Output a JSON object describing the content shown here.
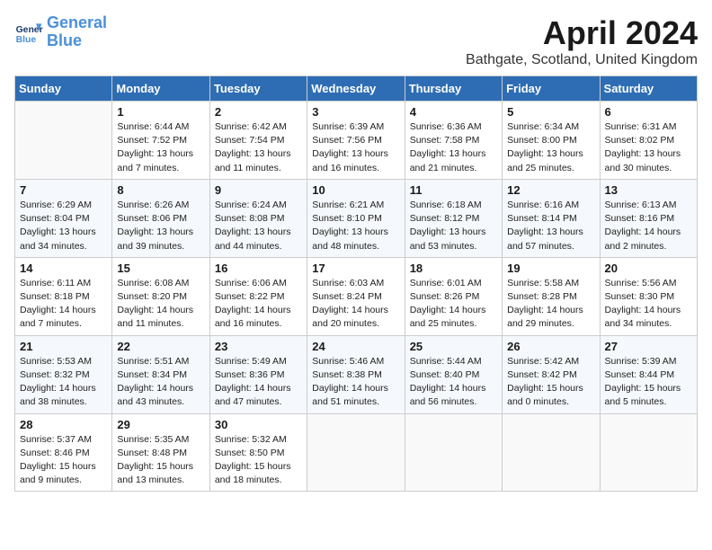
{
  "header": {
    "logo_line1": "General",
    "logo_line2": "Blue",
    "main_title": "April 2024",
    "subtitle": "Bathgate, Scotland, United Kingdom"
  },
  "days_of_week": [
    "Sunday",
    "Monday",
    "Tuesday",
    "Wednesday",
    "Thursday",
    "Friday",
    "Saturday"
  ],
  "weeks": [
    [
      {
        "day": "",
        "detail": ""
      },
      {
        "day": "1",
        "detail": "Sunrise: 6:44 AM\nSunset: 7:52 PM\nDaylight: 13 hours\nand 7 minutes."
      },
      {
        "day": "2",
        "detail": "Sunrise: 6:42 AM\nSunset: 7:54 PM\nDaylight: 13 hours\nand 11 minutes."
      },
      {
        "day": "3",
        "detail": "Sunrise: 6:39 AM\nSunset: 7:56 PM\nDaylight: 13 hours\nand 16 minutes."
      },
      {
        "day": "4",
        "detail": "Sunrise: 6:36 AM\nSunset: 7:58 PM\nDaylight: 13 hours\nand 21 minutes."
      },
      {
        "day": "5",
        "detail": "Sunrise: 6:34 AM\nSunset: 8:00 PM\nDaylight: 13 hours\nand 25 minutes."
      },
      {
        "day": "6",
        "detail": "Sunrise: 6:31 AM\nSunset: 8:02 PM\nDaylight: 13 hours\nand 30 minutes."
      }
    ],
    [
      {
        "day": "7",
        "detail": "Sunrise: 6:29 AM\nSunset: 8:04 PM\nDaylight: 13 hours\nand 34 minutes."
      },
      {
        "day": "8",
        "detail": "Sunrise: 6:26 AM\nSunset: 8:06 PM\nDaylight: 13 hours\nand 39 minutes."
      },
      {
        "day": "9",
        "detail": "Sunrise: 6:24 AM\nSunset: 8:08 PM\nDaylight: 13 hours\nand 44 minutes."
      },
      {
        "day": "10",
        "detail": "Sunrise: 6:21 AM\nSunset: 8:10 PM\nDaylight: 13 hours\nand 48 minutes."
      },
      {
        "day": "11",
        "detail": "Sunrise: 6:18 AM\nSunset: 8:12 PM\nDaylight: 13 hours\nand 53 minutes."
      },
      {
        "day": "12",
        "detail": "Sunrise: 6:16 AM\nSunset: 8:14 PM\nDaylight: 13 hours\nand 57 minutes."
      },
      {
        "day": "13",
        "detail": "Sunrise: 6:13 AM\nSunset: 8:16 PM\nDaylight: 14 hours\nand 2 minutes."
      }
    ],
    [
      {
        "day": "14",
        "detail": "Sunrise: 6:11 AM\nSunset: 8:18 PM\nDaylight: 14 hours\nand 7 minutes."
      },
      {
        "day": "15",
        "detail": "Sunrise: 6:08 AM\nSunset: 8:20 PM\nDaylight: 14 hours\nand 11 minutes."
      },
      {
        "day": "16",
        "detail": "Sunrise: 6:06 AM\nSunset: 8:22 PM\nDaylight: 14 hours\nand 16 minutes."
      },
      {
        "day": "17",
        "detail": "Sunrise: 6:03 AM\nSunset: 8:24 PM\nDaylight: 14 hours\nand 20 minutes."
      },
      {
        "day": "18",
        "detail": "Sunrise: 6:01 AM\nSunset: 8:26 PM\nDaylight: 14 hours\nand 25 minutes."
      },
      {
        "day": "19",
        "detail": "Sunrise: 5:58 AM\nSunset: 8:28 PM\nDaylight: 14 hours\nand 29 minutes."
      },
      {
        "day": "20",
        "detail": "Sunrise: 5:56 AM\nSunset: 8:30 PM\nDaylight: 14 hours\nand 34 minutes."
      }
    ],
    [
      {
        "day": "21",
        "detail": "Sunrise: 5:53 AM\nSunset: 8:32 PM\nDaylight: 14 hours\nand 38 minutes."
      },
      {
        "day": "22",
        "detail": "Sunrise: 5:51 AM\nSunset: 8:34 PM\nDaylight: 14 hours\nand 43 minutes."
      },
      {
        "day": "23",
        "detail": "Sunrise: 5:49 AM\nSunset: 8:36 PM\nDaylight: 14 hours\nand 47 minutes."
      },
      {
        "day": "24",
        "detail": "Sunrise: 5:46 AM\nSunset: 8:38 PM\nDaylight: 14 hours\nand 51 minutes."
      },
      {
        "day": "25",
        "detail": "Sunrise: 5:44 AM\nSunset: 8:40 PM\nDaylight: 14 hours\nand 56 minutes."
      },
      {
        "day": "26",
        "detail": "Sunrise: 5:42 AM\nSunset: 8:42 PM\nDaylight: 15 hours\nand 0 minutes."
      },
      {
        "day": "27",
        "detail": "Sunrise: 5:39 AM\nSunset: 8:44 PM\nDaylight: 15 hours\nand 5 minutes."
      }
    ],
    [
      {
        "day": "28",
        "detail": "Sunrise: 5:37 AM\nSunset: 8:46 PM\nDaylight: 15 hours\nand 9 minutes."
      },
      {
        "day": "29",
        "detail": "Sunrise: 5:35 AM\nSunset: 8:48 PM\nDaylight: 15 hours\nand 13 minutes."
      },
      {
        "day": "30",
        "detail": "Sunrise: 5:32 AM\nSunset: 8:50 PM\nDaylight: 15 hours\nand 18 minutes."
      },
      {
        "day": "",
        "detail": ""
      },
      {
        "day": "",
        "detail": ""
      },
      {
        "day": "",
        "detail": ""
      },
      {
        "day": "",
        "detail": ""
      }
    ]
  ]
}
